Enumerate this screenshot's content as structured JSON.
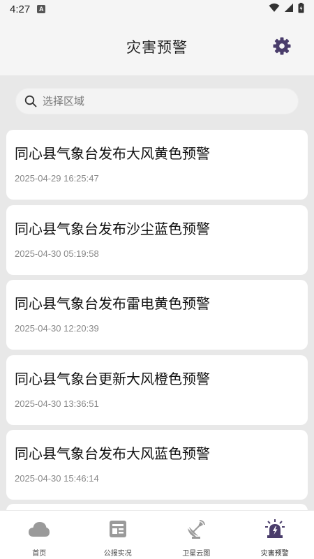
{
  "status_bar": {
    "time": "4:27",
    "notification_icon": "a-icon"
  },
  "header": {
    "title": "灾害预警",
    "settings_icon": "gear-icon"
  },
  "search": {
    "placeholder": "选择区域",
    "value": ""
  },
  "alerts": [
    {
      "title": "同心县气象台发布大风黄色预警",
      "time": "2025-04-29 16:25:47"
    },
    {
      "title": "同心县气象台发布沙尘蓝色预警",
      "time": "2025-04-30 05:19:58"
    },
    {
      "title": "同心县气象台发布雷电黄色预警",
      "time": "2025-04-30 12:20:39"
    },
    {
      "title": "同心县气象台更新大风橙色预警",
      "time": "2025-04-30 13:36:51"
    },
    {
      "title": "同心县气象台发布大风蓝色预警",
      "time": "2025-04-30 15:46:14"
    }
  ],
  "nav": [
    {
      "label": "首页",
      "icon": "cloud-icon"
    },
    {
      "label": "公报实况",
      "icon": "news-icon"
    },
    {
      "label": "卫星云图",
      "icon": "satellite-icon"
    },
    {
      "label": "灾害预警",
      "icon": "alarm-icon",
      "active": true
    }
  ],
  "colors": {
    "accent": "#4a3d6b",
    "icon_gray": "#9a9a9a",
    "background": "#e8e8e8"
  }
}
